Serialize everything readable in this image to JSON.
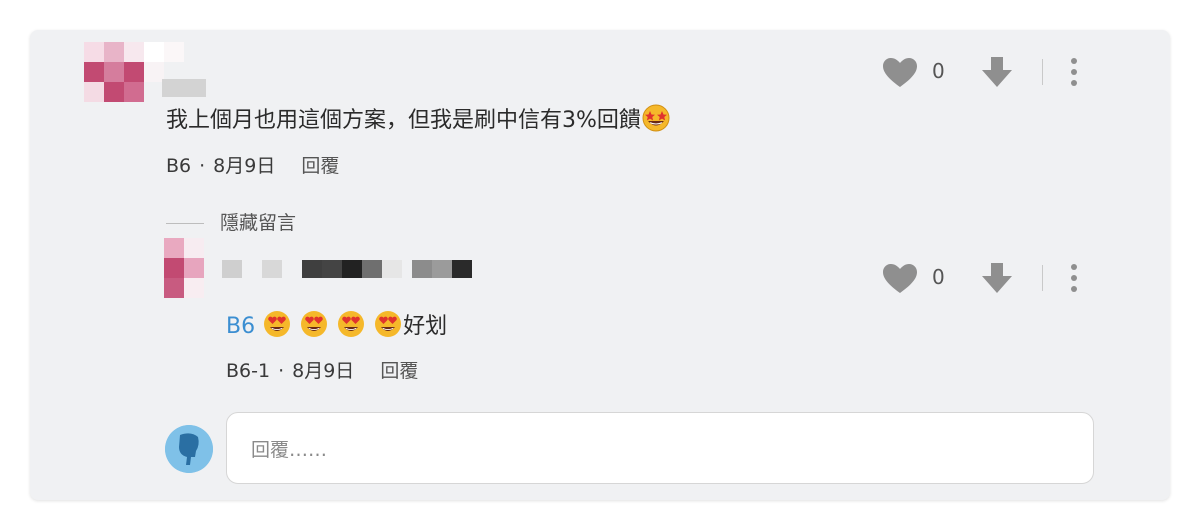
{
  "comments": [
    {
      "text": "我上個月也用這個方案，但我是刷中信有3%回饋",
      "floor": "B6",
      "date": "8月9日",
      "reply_label": "回覆",
      "likes": "0"
    }
  ],
  "hidden_toggle_label": "隱藏留言",
  "reply": {
    "mention": "B6",
    "text": "好划",
    "floor": "B6-1",
    "date": "8月9日",
    "reply_label": "回覆",
    "likes": "0"
  },
  "reply_box": {
    "placeholder": "回覆……"
  },
  "icons": {
    "like": "heart-icon",
    "dislike": "arrow-down-icon",
    "more": "more-vertical-icon",
    "emoji_starstruck": "star-struck-emoji",
    "emoji_hearteyes": "heart-eyes-emoji"
  },
  "colors": {
    "card_bg": "#f0f1f3",
    "mention": "#3b8ed1",
    "icon_gray": "#8f8f8f",
    "avatar_pink": "#c24a72",
    "reply_avatar_blue": "#7fc1e8"
  }
}
